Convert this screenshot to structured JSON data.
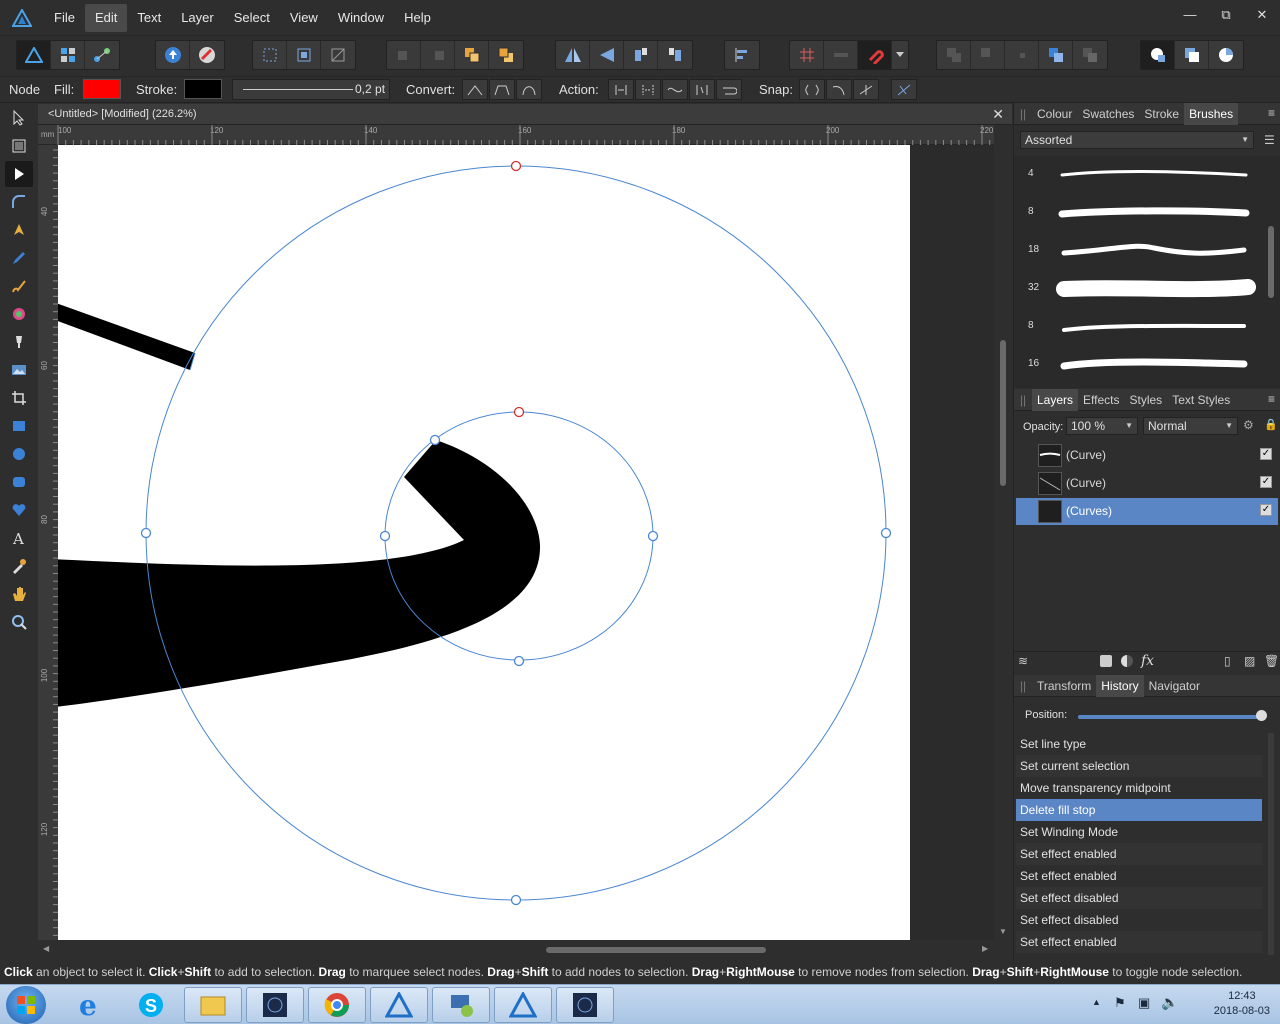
{
  "menu": [
    "File",
    "Edit",
    "Text",
    "Layer",
    "Select",
    "View",
    "Window",
    "Help"
  ],
  "window_controls": [
    "—",
    "⧉",
    "✕"
  ],
  "context": {
    "tool_label": "Node",
    "fill_label": "Fill:",
    "fill_color": "#ff0000",
    "stroke_label": "Stroke:",
    "stroke_color": "#000000",
    "stroke_width": "0,2 pt",
    "convert_label": "Convert:",
    "action_label": "Action:",
    "snap_label": "Snap:"
  },
  "document": {
    "tab_title": "<Untitled> [Modified] (226.2%)",
    "close": "✕",
    "ruler_unit": "mm",
    "hruler_labels": [
      "100",
      "120",
      "140",
      "160",
      "180",
      "200",
      "220"
    ],
    "vruler_labels": [
      "40",
      "60",
      "80",
      "100",
      "120"
    ]
  },
  "brushes_panel": {
    "tabs": [
      "Colour",
      "Swatches",
      "Stroke",
      "Brushes"
    ],
    "active_tab": "Brushes",
    "category": "Assorted",
    "sizes": [
      "4",
      "8",
      "18",
      "32",
      "8",
      "16"
    ]
  },
  "layers_panel": {
    "tabs": [
      "Layers",
      "Effects",
      "Styles",
      "Text Styles"
    ],
    "active_tab": "Layers",
    "opacity_label": "Opacity:",
    "opacity_value": "100 %",
    "blend_mode": "Normal",
    "layers": [
      {
        "name": "(Curve)",
        "selected": false
      },
      {
        "name": "(Curve)",
        "selected": false
      },
      {
        "name": "(Curves)",
        "selected": true
      }
    ],
    "fx_label": "fx"
  },
  "history_panel": {
    "tabs": [
      "Transform",
      "History",
      "Navigator"
    ],
    "active_tab": "History",
    "position_label": "Position:",
    "position_value": 1.0,
    "items": [
      "Set line type",
      "Set current selection",
      "Move transparency midpoint",
      "Delete fill stop",
      "Set Winding Mode",
      "Set effect enabled",
      "Set effect enabled",
      "Set effect disabled",
      "Set effect disabled",
      "Set effect enabled"
    ],
    "selected_index": 3
  },
  "status": {
    "parts": [
      {
        "b": "Click",
        "t": " an object to select it. "
      },
      {
        "b": "Click",
        "t": "+"
      },
      {
        "b": "Shift",
        "t": " to add to selection. "
      },
      {
        "b": "Drag",
        "t": " to marquee select nodes. "
      },
      {
        "b": "Drag",
        "t": "+"
      },
      {
        "b": "Shift",
        "t": " to add nodes to selection. "
      },
      {
        "b": "Drag",
        "t": "+"
      },
      {
        "b": "RightMouse",
        "t": " to remove nodes from selection. "
      },
      {
        "b": "Drag",
        "t": "+"
      },
      {
        "b": "Shift",
        "t": "+"
      },
      {
        "b": "RightMouse",
        "t": " to toggle node selection."
      }
    ]
  },
  "taskbar": {
    "time": "12:43",
    "date": "2018-08-03"
  },
  "colors": {
    "accent": "#5b86c6",
    "selection_circle": "#4a86d0",
    "node_red": "#d0312d"
  }
}
